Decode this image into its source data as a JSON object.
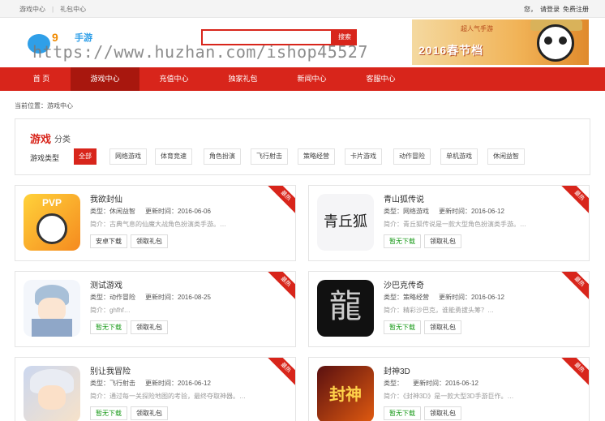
{
  "topbar": {
    "links": [
      "游戏中心",
      "礼包中心"
    ],
    "right_greeting": "您，",
    "login": "请登录",
    "register": "免费注册"
  },
  "header": {
    "logo_text": "手游",
    "search_placeholder": "",
    "search_button": "搜索",
    "banner_title": "2016春节档",
    "banner_subtitle": "超人气手游"
  },
  "watermark": "https://www.huzhan.com/ishop45527",
  "nav": {
    "items": [
      "首 页",
      "游戏中心",
      "充值中心",
      "独家礼包",
      "新闻中心",
      "客服中心"
    ],
    "active_index": 1
  },
  "breadcrumb": "当前位置：游戏中心",
  "filter": {
    "title_main": "游戏",
    "title_sub": "分类",
    "label": "游戏类型",
    "tags": [
      "全部",
      "网络游戏",
      "体育竞速",
      "角色扮演",
      "飞行射击",
      "策略经营",
      "卡片游戏",
      "动作冒险",
      "单机游戏",
      "休闲益智"
    ],
    "active_index": 0
  },
  "games": [
    {
      "name": "我欲封仙",
      "type_label": "类型：休闲益智",
      "time_label": "更新时间：2016-06-06",
      "desc": "简介：古典气息的仙魔大战角色扮演类手游。…",
      "btn1": "安卓下载",
      "btn2": "领取礼包",
      "ribbon": "最热",
      "icon": "panda-hero-icon",
      "icon_glyph": "PVP"
    },
    {
      "name": "青山狐传说",
      "type_label": "类型：网络游戏",
      "time_label": "更新时间：2016-06-12",
      "desc": "简介：青丘狐传说是一款大型角色扮演类手游。…",
      "btn1": "暂无下载",
      "btn2": "领取礼包",
      "ribbon": "最热",
      "icon": "fox-calligraphy-icon",
      "icon_glyph": "青丘狐"
    },
    {
      "name": "测试游戏",
      "type_label": "类型：动作冒险",
      "time_label": "更新时间：2016-08-25",
      "desc": "简介：ghfhf…",
      "btn1": "暂无下载",
      "btn2": "领取礼包",
      "ribbon": "最热",
      "icon": "anime-character-icon",
      "icon_glyph": ""
    },
    {
      "name": "沙巴克传奇",
      "type_label": "类型：策略经营",
      "time_label": "更新时间：2016-06-12",
      "desc": "简介：精彩沙巴克，谁能勇拔头筹？…",
      "btn1": "暂无下载",
      "btn2": "领取礼包",
      "ribbon": "最热",
      "icon": "dragon-glyph-icon",
      "icon_glyph": "龍"
    },
    {
      "name": "别让我冒险",
      "type_label": "类型：飞行射击",
      "time_label": "更新时间：2016-06-12",
      "desc": "简介：通过每一关探险地图的考验，最终夺取神器。…",
      "btn1": "暂无下载",
      "btn2": "领取礼包",
      "ribbon": "最热",
      "icon": "silver-hair-hero-icon",
      "icon_glyph": ""
    },
    {
      "name": "封神3D",
      "type_label": "类型：",
      "time_label": "更新时间：2016-06-12",
      "desc": "简介：《封神3D》是一款大型3D手游巨作。…",
      "btn1": "暂无下载",
      "btn2": "领取礼包",
      "ribbon": "最热",
      "icon": "fengshen-3d-icon",
      "icon_glyph": "封神"
    }
  ],
  "colors": {
    "brand_red": "#d8251b",
    "nav_active": "#a8170e",
    "download_green": "#1a9a1a"
  }
}
